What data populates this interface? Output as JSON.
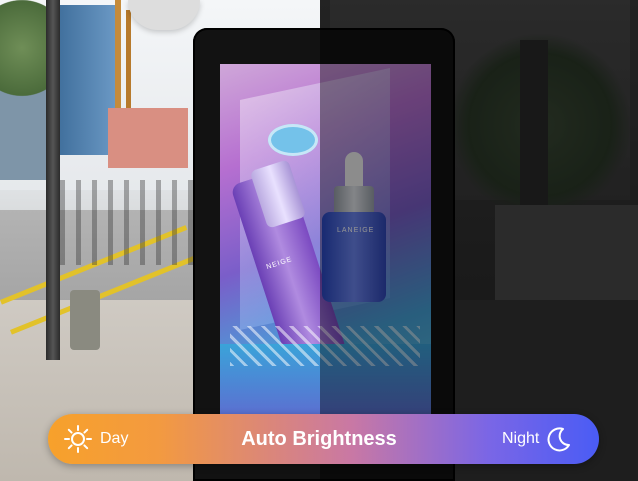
{
  "brightness_bar": {
    "day_label": "Day",
    "title": "Auto Brightness",
    "night_label": "Night",
    "day_icon": "sun-icon",
    "night_icon": "moon-icon",
    "colors": {
      "day": "#f7a12b",
      "night": "#4a5cf5"
    }
  },
  "advertisement": {
    "brand_primary": "NEIGE",
    "brand_secondary": "LANEIGE"
  }
}
